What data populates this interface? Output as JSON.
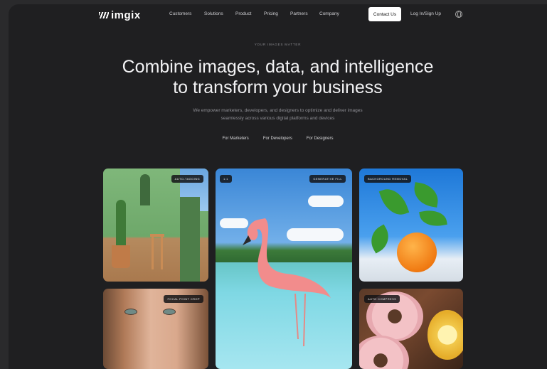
{
  "nav": {
    "logo": "imgix",
    "links": [
      "Customers",
      "Solutions",
      "Product",
      "Pricing",
      "Partners",
      "Company"
    ],
    "contact": "Contact Us",
    "login": "Log In/Sign Up"
  },
  "hero": {
    "eyebrow": "YOUR IMAGES MATTER",
    "headline_1": "Combine images, data, and intelligence",
    "headline_2": "to transform your business",
    "sub_1": "We empower marketers, developers, and designers to optimize and deliver images",
    "sub_2": "seamlessly across various digital platforms and devices",
    "audiences": [
      "For Marketers",
      "For Developers",
      "For Designers"
    ]
  },
  "cards": {
    "c1_tag": "AUTO-TAGGING",
    "c2_tag": "GENERATIVE FILL",
    "c2_tag_left": "1:1",
    "c3_tag": "BACKGROUND REMOVAL",
    "c4_tag": "FOCAL POINT CROP",
    "c5_tag": "AUTO COMPRESS"
  }
}
